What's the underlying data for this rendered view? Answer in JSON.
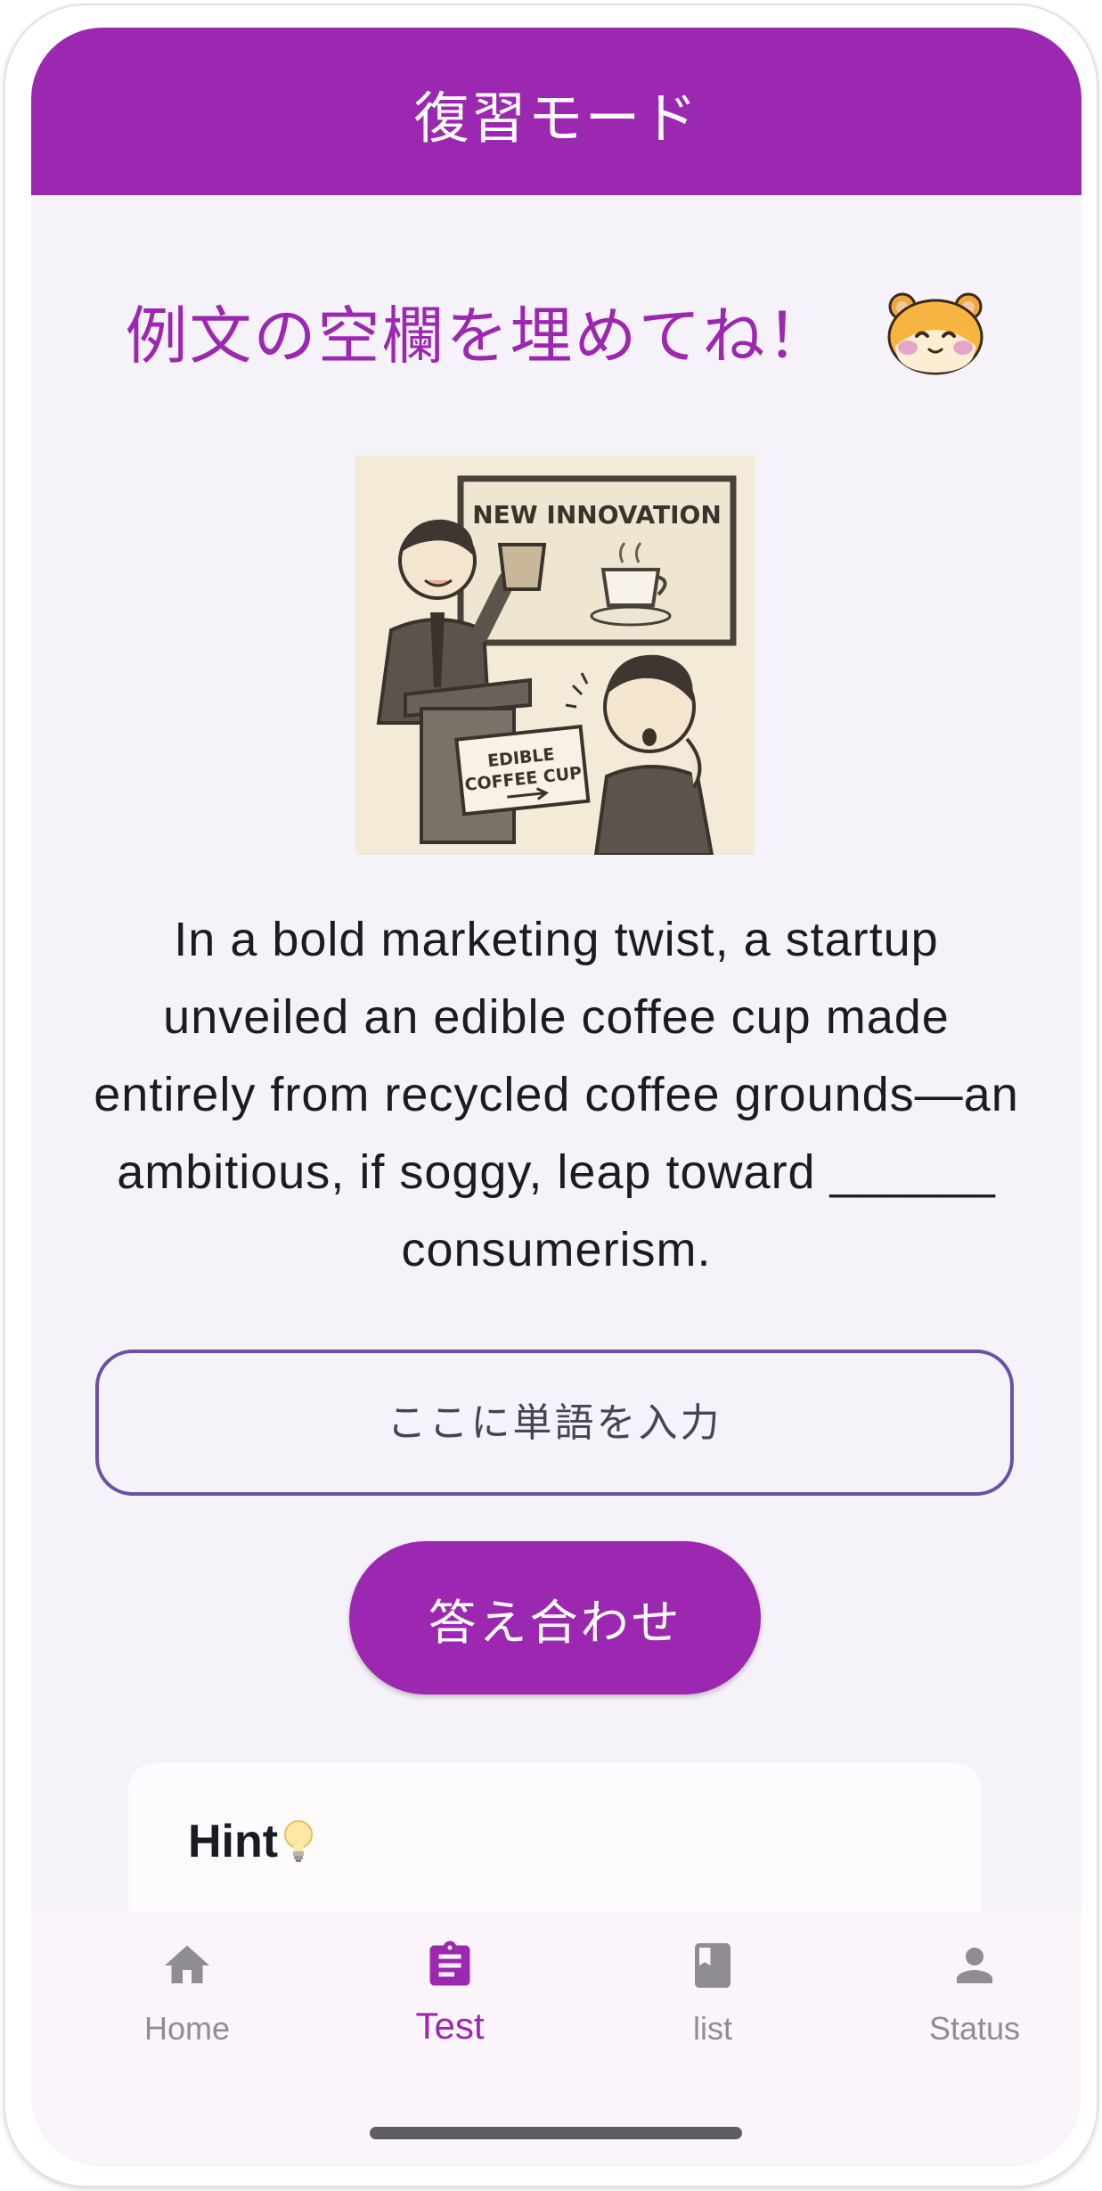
{
  "app_bar": {
    "title": "復習モード"
  },
  "heading": {
    "text": "例文の空欄を埋めてね！"
  },
  "illustration": {
    "sign_top": "NEW INNOVATION",
    "sign_bottom_line1": "EDIBLE",
    "sign_bottom_line2": "COFFEE CUP"
  },
  "question": {
    "sentence": "In a bold marketing twist, a startup unveiled an edible coffee cup made entirely from recycled coffee grounds—an ambitious, if soggy, leap toward ______ consumerism."
  },
  "answer": {
    "placeholder": "ここに単語を入力",
    "value": ""
  },
  "check_button": {
    "label": "答え合わせ"
  },
  "hint": {
    "title": "Hint",
    "icon": "lightbulb-icon"
  },
  "nav": {
    "items": [
      {
        "label": "Home",
        "icon": "home-icon",
        "active": false
      },
      {
        "label": "Test",
        "icon": "clipboard-icon",
        "active": true
      },
      {
        "label": "list",
        "icon": "book-icon",
        "active": false
      },
      {
        "label": "Status",
        "icon": "person-icon",
        "active": false
      }
    ]
  },
  "colors": {
    "primary": "#9c27b0",
    "background": "#f5f2f9",
    "input_border": "#6c4fa6",
    "nav_inactive": "#8f8d93"
  }
}
